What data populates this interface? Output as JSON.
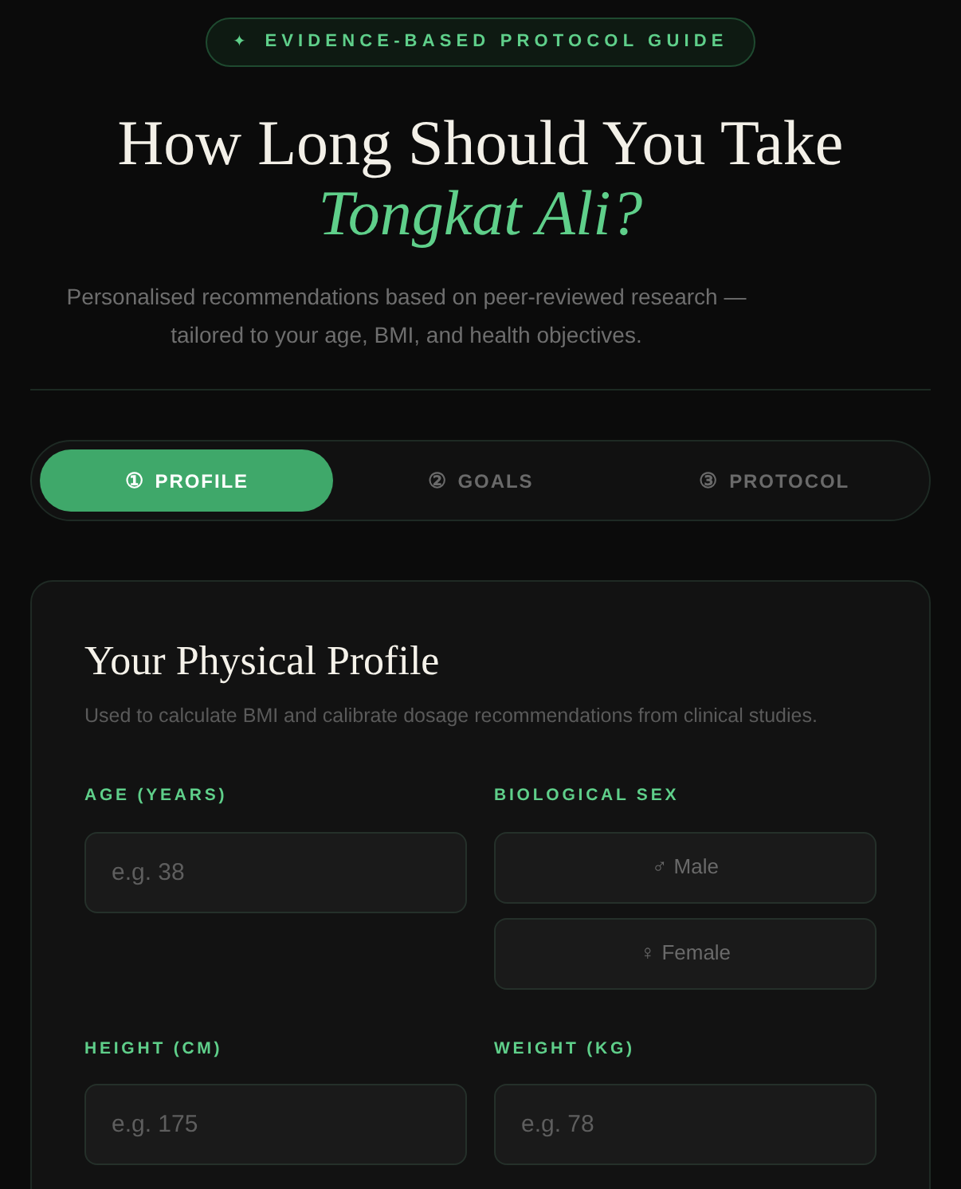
{
  "badge": {
    "icon": "✦",
    "label": "EVIDENCE-BASED PROTOCOL GUIDE"
  },
  "heading": {
    "line_1": "How Long Should You Take",
    "line_2": "Tongkat Ali?"
  },
  "subtitle": "Personalised recommendations based on peer-reviewed research — tailored to your age, BMI, and health objectives.",
  "steps": [
    {
      "number": "①",
      "label": "PROFILE",
      "selected": true
    },
    {
      "number": "②",
      "label": "GOALS",
      "selected": false
    },
    {
      "number": "③",
      "label": "PROTOCOL",
      "selected": false
    }
  ],
  "card": {
    "title": "Your Physical Profile",
    "description": "Used to calculate BMI and calibrate dosage recommendations from clinical studies.",
    "fields": [
      {
        "kind": "input",
        "label": "AGE (YEARS)",
        "placeholder": "e.g. 38"
      },
      {
        "kind": "choice",
        "label": "BIOLOGICAL SEX",
        "options": [
          {
            "symbol": "♂",
            "label": "Male",
            "selected": false
          },
          {
            "symbol": "♀",
            "label": "Female",
            "selected": false
          }
        ]
      },
      {
        "kind": "input",
        "label": "HEIGHT (CM)",
        "placeholder": "e.g. 175"
      },
      {
        "kind": "input",
        "label": "WEIGHT (KG)",
        "placeholder": "e.g. 78"
      }
    ]
  }
}
